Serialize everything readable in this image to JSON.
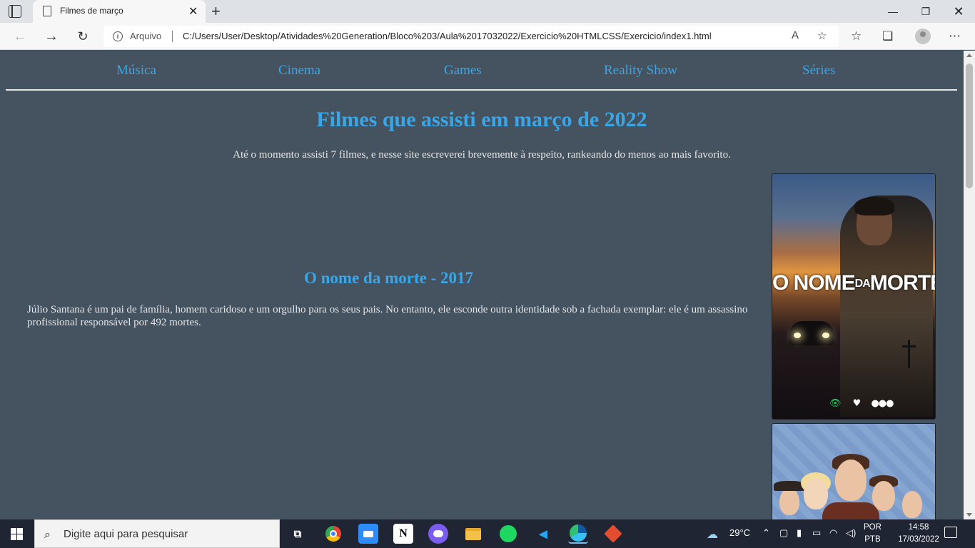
{
  "browser": {
    "tab_title": "Filmes de março",
    "address_label": "Arquivo",
    "url": "C:/Users/User/Desktop/Atividades%20Generation/Bloco%203/Aula%2017032022/Exercicio%20HTMLCSS/Exercicio/index1.html"
  },
  "page": {
    "menu": [
      "Música",
      "Cinema",
      "Games",
      "Reality Show",
      "Séries"
    ],
    "title": "Filmes que assisti em março de 2022",
    "intro": "Até o momento assisti 7 filmes, e nesse site escreverei brevemente à respeito, rankeando do menos ao mais favorito.",
    "movie": {
      "title": "O nome da morte - 2017",
      "description": "Júlio Santana é um pai de família, homem caridoso e um orgulho para os seus pais. No entanto, ele esconde outra identidade sob a fachada exemplar: ele é um assassino profissional responsável por 492 mortes.",
      "poster_title_part1": "O NOME",
      "poster_title_part2": "DA",
      "poster_title_part3": "MORTE"
    }
  },
  "taskbar": {
    "search_placeholder": "Digite aqui para pesquisar",
    "weather": "29°C",
    "language_line1": "POR",
    "language_line2": "PTB",
    "time": "14:58",
    "date": "17/03/2022"
  },
  "colors": {
    "page_background": "#455260",
    "accent_blue": "#3ba6e6",
    "body_text": "#e6e6e6",
    "watched_green": "#1fd15f"
  },
  "icons": {
    "browser": [
      "tab-actions-icon",
      "document-icon",
      "close-icon",
      "plus-icon",
      "minimize-icon",
      "restore-icon",
      "back-icon",
      "forward-icon",
      "reload-icon",
      "info-icon",
      "read-aloud-icon",
      "add-favorite-icon",
      "favorites-icon",
      "collections-icon",
      "profile-icon",
      "more-icon"
    ],
    "poster": [
      "eye-icon",
      "heart-icon",
      "more-icon"
    ],
    "taskbar": [
      "windows-start-icon",
      "search-icon",
      "task-view-icon",
      "chrome-icon",
      "zoom-icon",
      "notion-icon",
      "discord-icon",
      "file-explorer-icon",
      "spotify-icon",
      "vscode-icon",
      "edge-icon",
      "git-icon",
      "weather-icon",
      "chevron-up-icon",
      "camera-icon",
      "microphone-icon",
      "battery-icon",
      "wifi-icon",
      "volume-icon",
      "notification-icon"
    ]
  }
}
